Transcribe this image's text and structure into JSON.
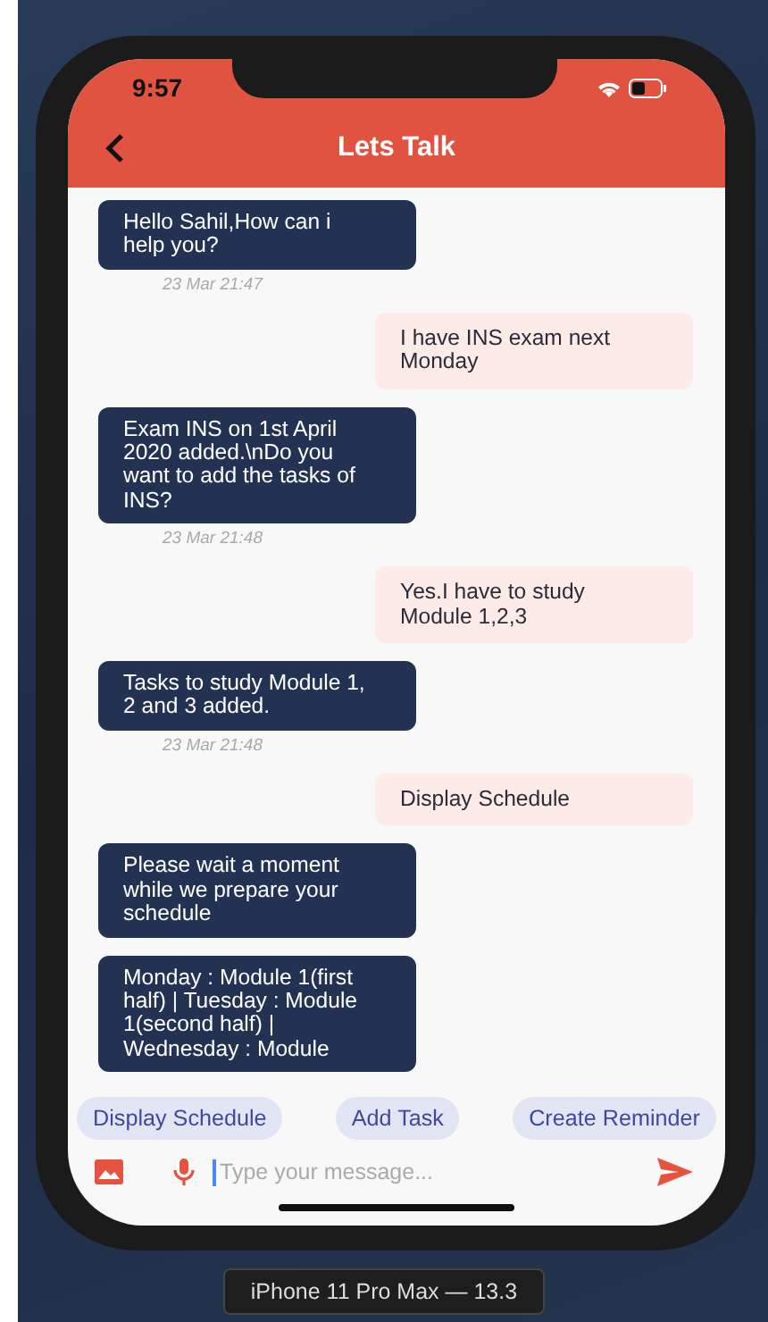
{
  "status_bar": {
    "time": "9:57"
  },
  "header": {
    "title": "Lets Talk"
  },
  "messages": [
    {
      "kind": "bot",
      "text": "Hello Sahil,How can i help you?",
      "time": "23 Mar 21:47"
    },
    {
      "kind": "user",
      "text": "I have INS exam next Monday"
    },
    {
      "kind": "bot",
      "text": "Exam INS on 1st April 2020 added.\\nDo you want to add the tasks of INS?",
      "time": "23 Mar 21:48"
    },
    {
      "kind": "user",
      "text": "Yes.I have to study Module 1,2,3"
    },
    {
      "kind": "bot",
      "text": "Tasks to study Module 1, 2 and 3 added.",
      "time": "23 Mar 21:48"
    },
    {
      "kind": "user",
      "text": "Display Schedule"
    },
    {
      "kind": "bot",
      "text": "Please wait a moment while we prepare your schedule"
    },
    {
      "kind": "bot",
      "text": "Monday : Module 1(first half) | Tuesday : Module 1(second half) | Wednesday : Module"
    }
  ],
  "quick_replies": [
    "Display Schedule",
    "Add Task",
    "Create Reminder"
  ],
  "composer": {
    "placeholder": "Type your message..."
  },
  "device_label": "iPhone 11 Pro Max — 13.3"
}
